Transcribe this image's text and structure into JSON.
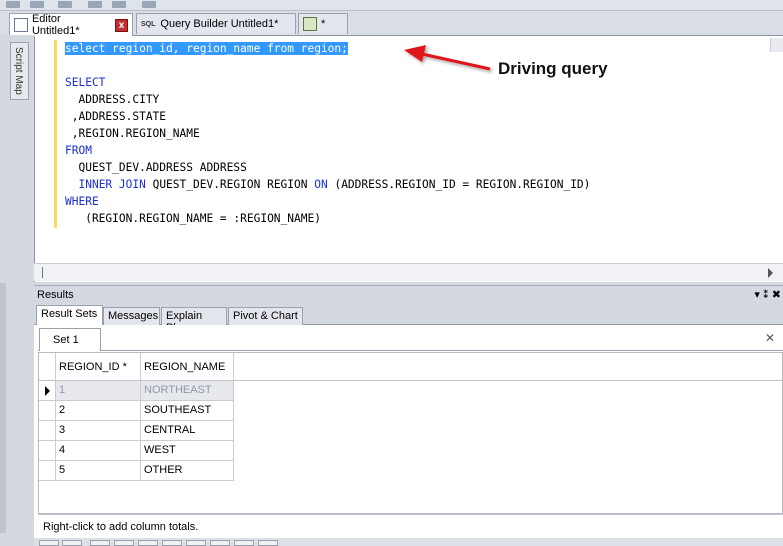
{
  "doc_tabs": {
    "editor": "Editor Untitled1*",
    "editor_close": "x",
    "query_builder_icon": "SQL",
    "query_builder": "Query Builder Untitled1*",
    "third_suffix": "*"
  },
  "side_panel": {
    "script_map": "Script Map"
  },
  "editor": {
    "line_driving": "select region_id, region_name from region;",
    "line_select": "SELECT",
    "line_city": "  ADDRESS.CITY",
    "line_state": " ,ADDRESS.STATE",
    "line_region_name": " ,REGION.REGION_NAME",
    "line_from": "FROM",
    "line_table": "  QUEST_DEV.ADDRESS ADDRESS",
    "kw_inner_join": "INNER JOIN",
    "join_table": " QUEST_DEV.REGION REGION ",
    "kw_on": "ON",
    "join_cond": " (ADDRESS.REGION_ID = REGION.REGION_ID)",
    "line_where": "WHERE",
    "line_cond": "   (REGION.REGION_NAME = :REGION_NAME)"
  },
  "annotation": {
    "label": "Driving query",
    "arrow_color": "#e0191b"
  },
  "results": {
    "title": "Results",
    "pin_glyph": "▾ ⁑ ✖",
    "tabs": [
      "Result Sets",
      "Messages",
      "Explain Plan",
      "Pivot & Chart"
    ],
    "set_tab": "Set 1",
    "set_close": "✕",
    "columns": [
      "REGION_ID *",
      "REGION_NAME"
    ],
    "rows": [
      {
        "id": "1",
        "name": "NORTHEAST"
      },
      {
        "id": "2",
        "name": "SOUTHEAST"
      },
      {
        "id": "3",
        "name": "CENTRAL"
      },
      {
        "id": "4",
        "name": "WEST"
      },
      {
        "id": "5",
        "name": "OTHER"
      }
    ],
    "footer_hint": "Right-click to add column totals."
  },
  "colors": {
    "keyword": "#1a2fd6",
    "selection": "#3399ff",
    "gutter": "#f2df5a"
  }
}
